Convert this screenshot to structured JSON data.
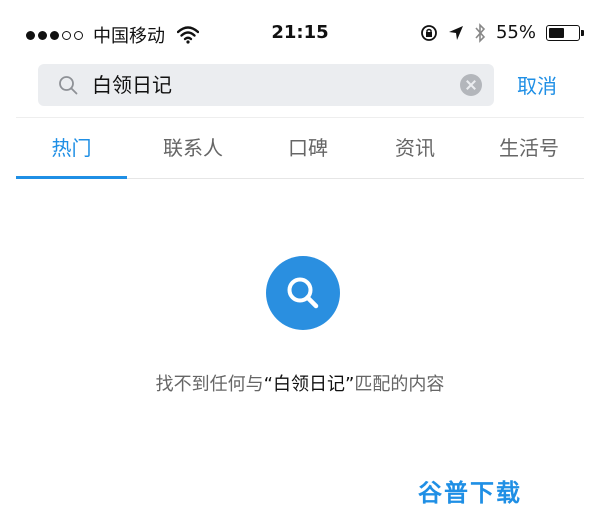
{
  "status_bar": {
    "carrier": "中国移动",
    "time": "21:15",
    "battery": "55%",
    "battery_level": 0.55,
    "icons": [
      "signal-dots",
      "wifi-icon",
      "rotation-lock-icon",
      "location-arrow-icon",
      "bluetooth-icon",
      "battery-icon"
    ]
  },
  "search": {
    "query": "白领日记",
    "cancel_label": "取消"
  },
  "tabs": [
    {
      "label": "热门",
      "active": true
    },
    {
      "label": "联系人",
      "active": false
    },
    {
      "label": "口碑",
      "active": false
    },
    {
      "label": "资讯",
      "active": false
    },
    {
      "label": "生活号",
      "active": false
    }
  ],
  "empty_state": {
    "prefix": "找不到任何与",
    "keyword": "“白领日记”",
    "suffix": "匹配的内容"
  },
  "watermark": "谷普下载",
  "colors": {
    "accent": "#1f8fe5",
    "search_bg": "#ebedf0",
    "muted_text": "#666666"
  }
}
